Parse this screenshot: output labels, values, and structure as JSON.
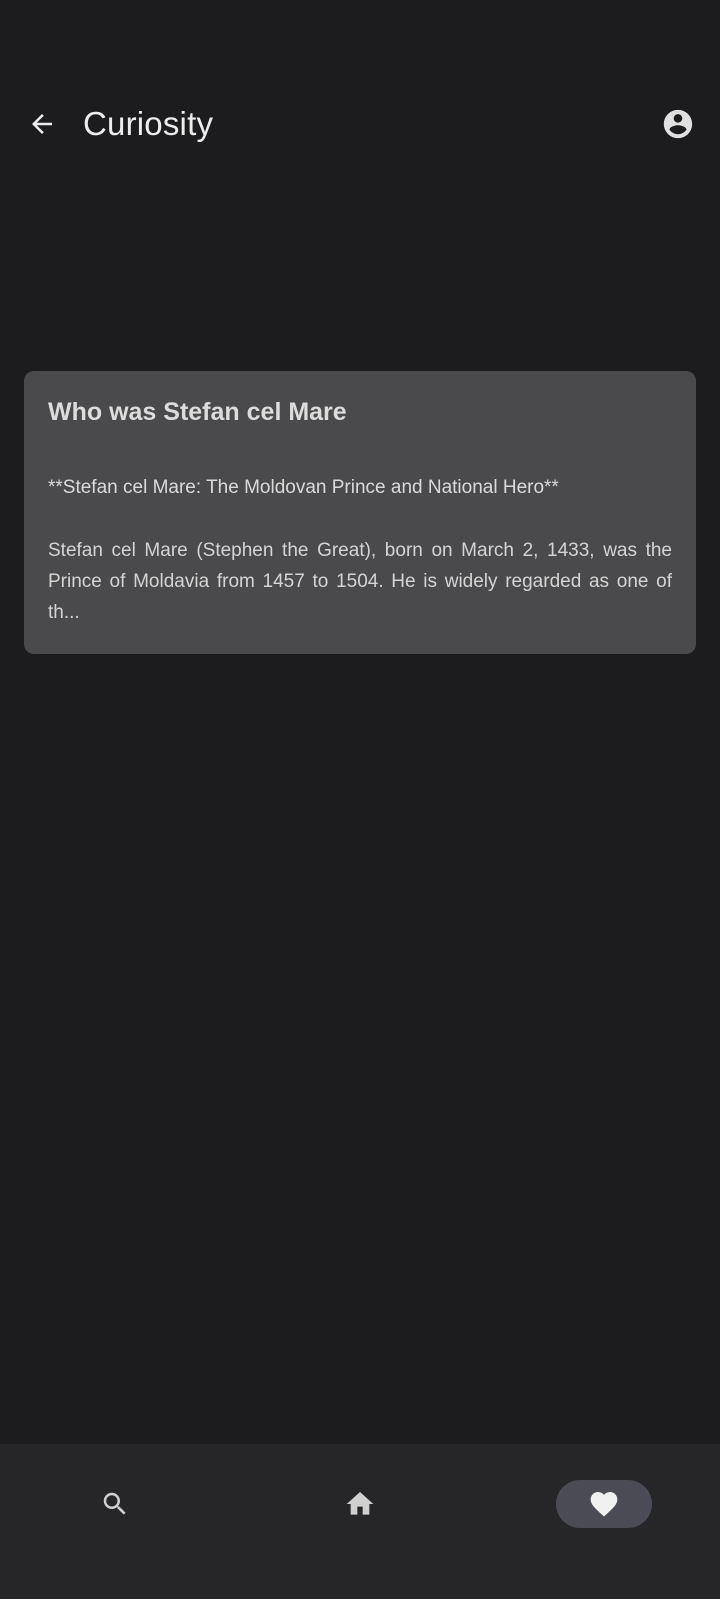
{
  "header": {
    "title": "Curiosity",
    "back_icon": "arrow-back-icon",
    "account_icon": "account-circle-icon"
  },
  "card": {
    "title": "Who was Stefan cel Mare",
    "subtitle": "**Stefan cel Mare: The Moldovan Prince and National Hero**",
    "body": "Stefan cel Mare (Stephen the Great), born on March 2, 1433, was the Prince of Moldavia from 1457 to 1504. He is widely regarded as one of th..."
  },
  "bottom_nav": {
    "items": [
      {
        "icon": "search-icon",
        "selected": false
      },
      {
        "icon": "home-icon",
        "selected": false
      },
      {
        "icon": "heart-icon",
        "selected": true
      }
    ]
  },
  "colors": {
    "background": "#1c1c1e",
    "card": "#4a4a4c",
    "nav_bar": "#262629",
    "nav_selected_pill": "#4a4b55"
  }
}
